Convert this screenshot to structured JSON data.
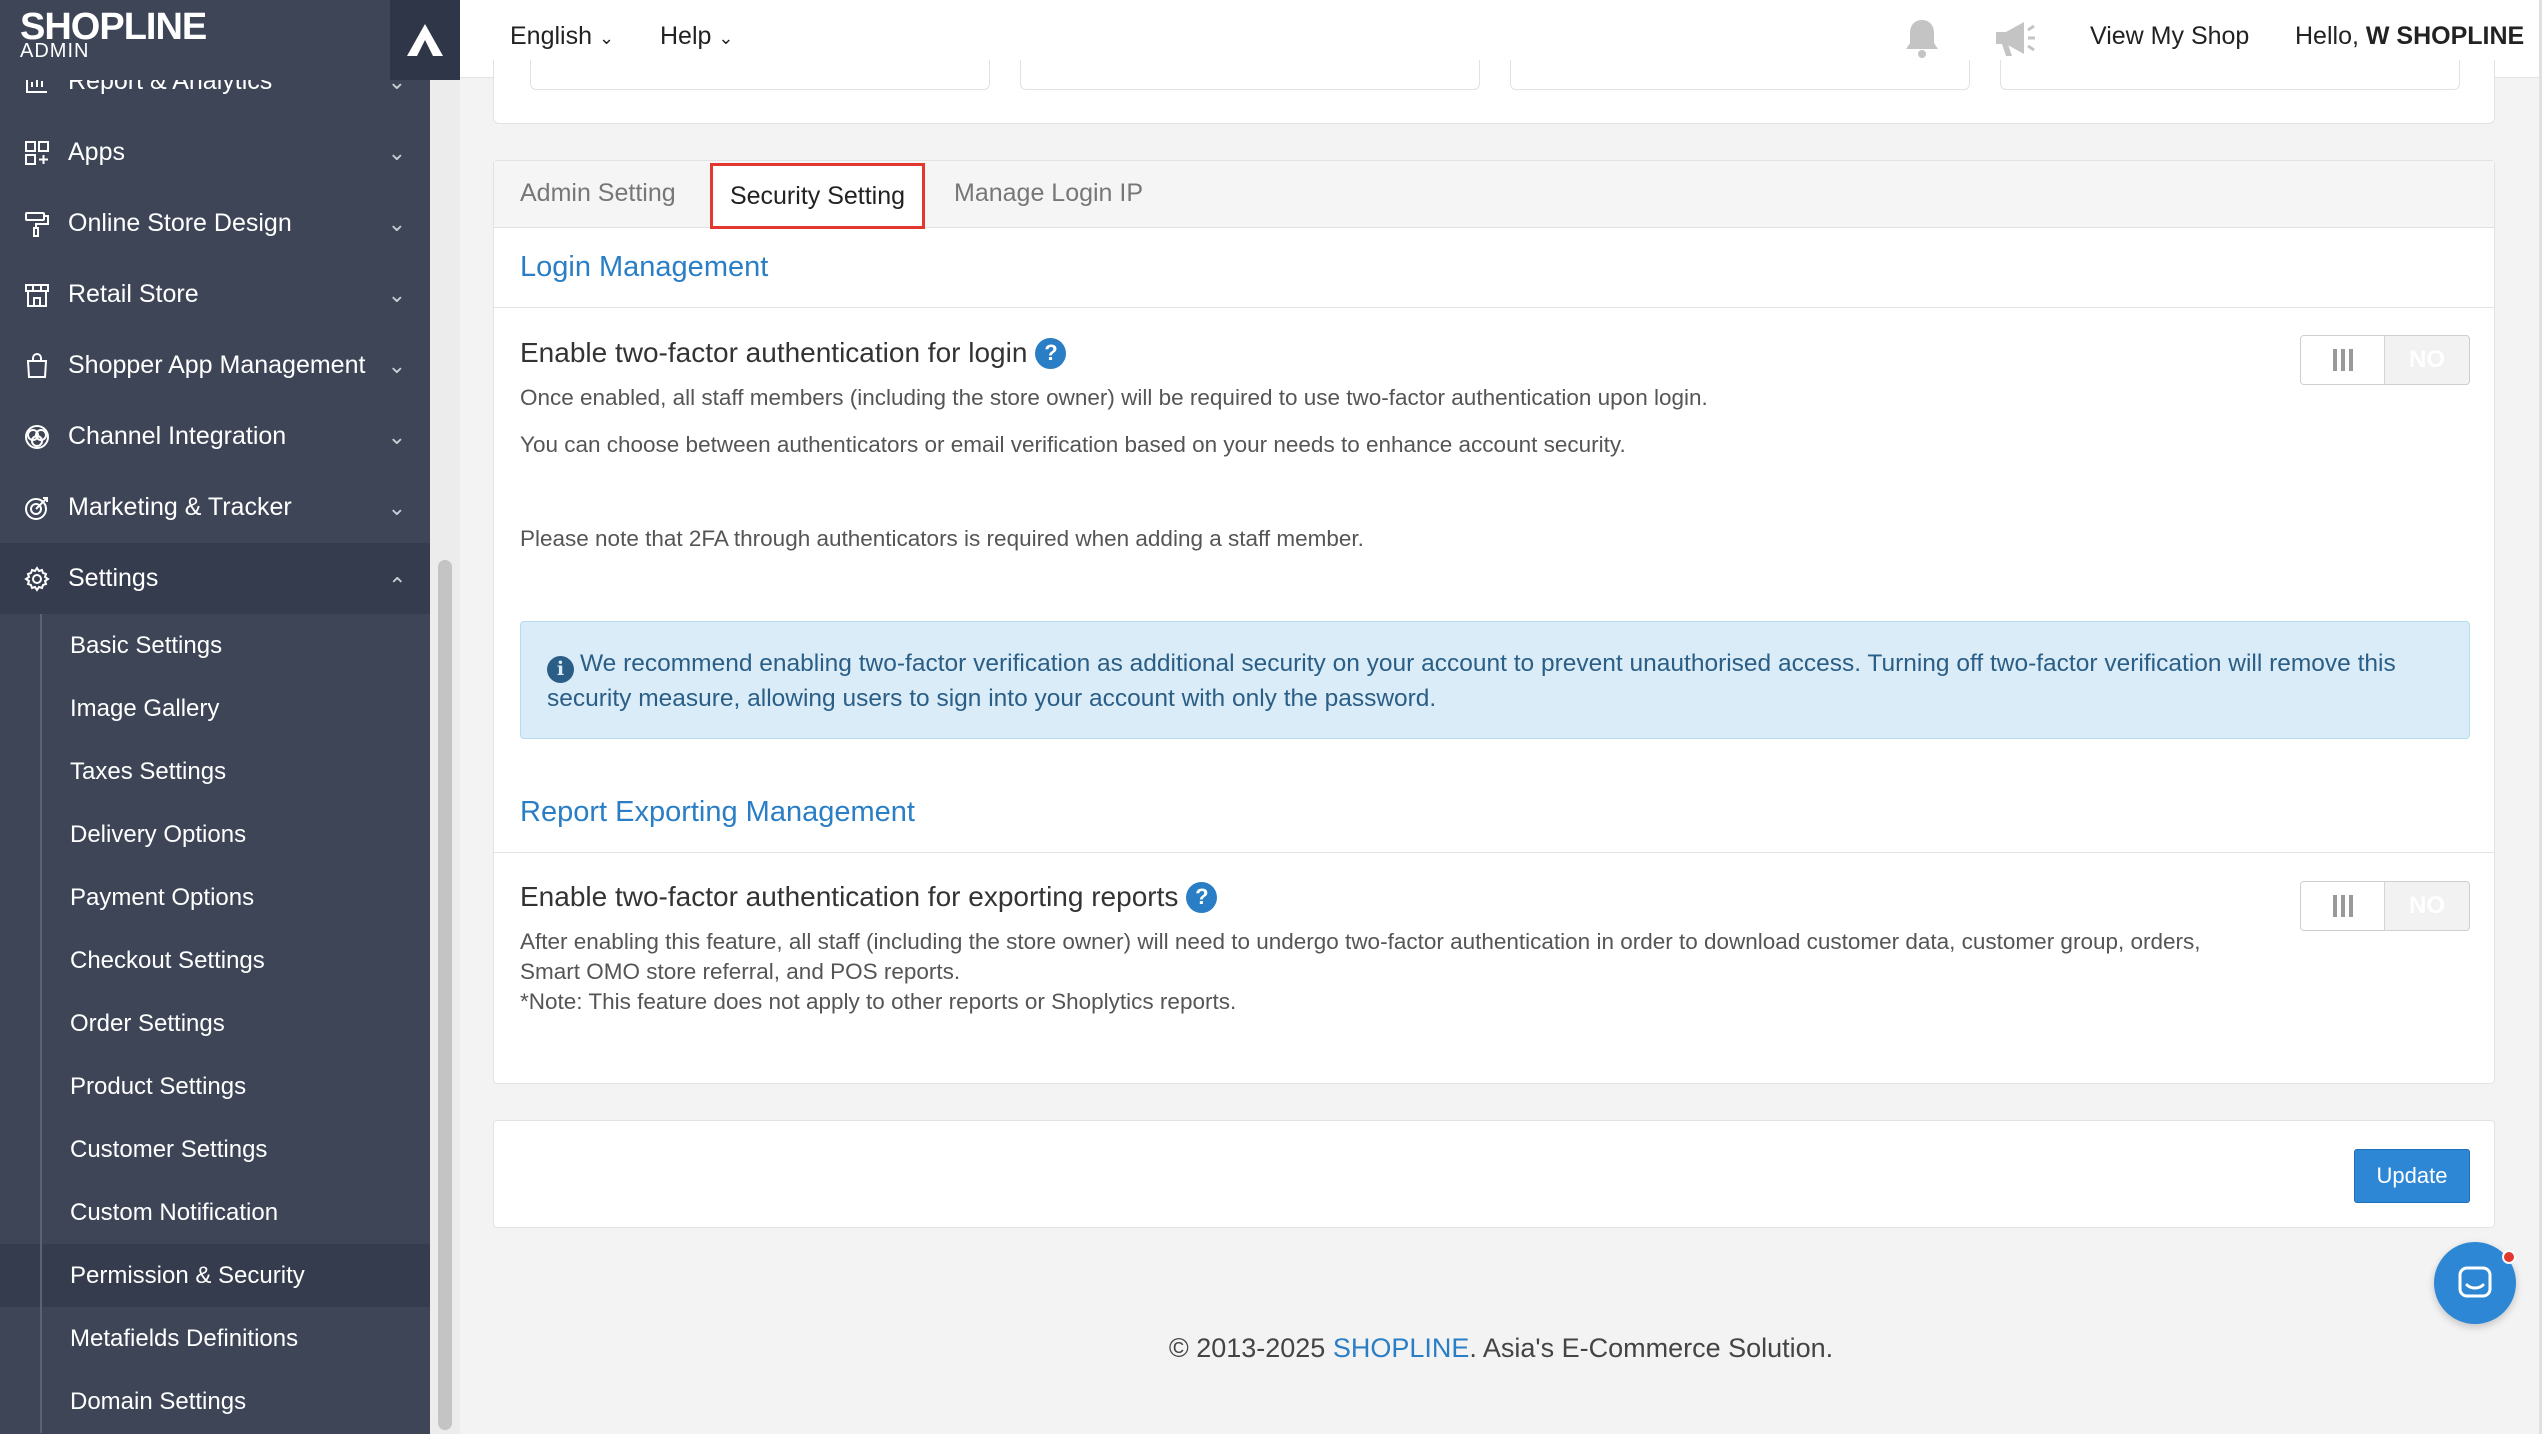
{
  "brand": {
    "logo": "SHOPLINE",
    "sub": "ADMIN"
  },
  "topbar": {
    "language": "English",
    "help": "Help",
    "view_shop": "View My Shop",
    "greeting": "Hello,",
    "user": "W SHOPLINE"
  },
  "sidebar": {
    "items": [
      {
        "label": "Report & Analytics",
        "icon": "chart-icon"
      },
      {
        "label": "Apps",
        "icon": "apps-icon"
      },
      {
        "label": "Online Store Design",
        "icon": "paint-roller-icon"
      },
      {
        "label": "Retail Store",
        "icon": "store-icon"
      },
      {
        "label": "Shopper App Management",
        "icon": "shopping-bag-icon"
      },
      {
        "label": "Channel Integration",
        "icon": "channel-icon"
      },
      {
        "label": "Marketing & Tracker",
        "icon": "target-icon"
      },
      {
        "label": "Settings",
        "icon": "gear-icon"
      }
    ],
    "settings_sub": [
      "Basic Settings",
      "Image Gallery",
      "Taxes Settings",
      "Delivery Options",
      "Payment Options",
      "Checkout Settings",
      "Order Settings",
      "Product Settings",
      "Customer Settings",
      "Custom Notification",
      "Permission & Security",
      "Metafields Definitions",
      "Domain Settings"
    ]
  },
  "tabs": [
    "Admin Setting",
    "Security Setting",
    "Manage Login IP"
  ],
  "login": {
    "section_title": "Login Management",
    "setting_title": "Enable two-factor authentication for login",
    "desc1": "Once enabled, all staff members (including the store owner) will be required to use two-factor authentication upon login.",
    "desc2": "You can choose between authenticators or email verification based on your needs to enhance account security.",
    "desc3": "Please note that 2FA through authenticators is required when adding a staff member.",
    "toggle": "NO",
    "info": "We recommend enabling two-factor verification as additional security on your account to prevent unauthorised access. Turning off two-factor verification will remove this security measure, allowing users to sign into your account with only the password."
  },
  "report": {
    "section_title": "Report Exporting Management",
    "setting_title": "Enable two-factor authentication for exporting reports",
    "desc1": "After enabling this feature, all staff (including the store owner) will need to undergo two-factor authentication in order to download customer data, customer group, orders,",
    "desc2": "Smart OMO store referral, and POS reports.",
    "desc3": "*Note: This feature does not apply to other reports or Shoplytics reports.",
    "toggle": "NO"
  },
  "update_label": "Update",
  "footer": {
    "prefix": "© 2013-2025 ",
    "brand": "SHOPLINE",
    "suffix": ". Asia's E-Commerce Solution."
  },
  "colors": {
    "sidebar": "#3d4557",
    "accent": "#2a7ec5",
    "highlight": "#e2382f"
  }
}
